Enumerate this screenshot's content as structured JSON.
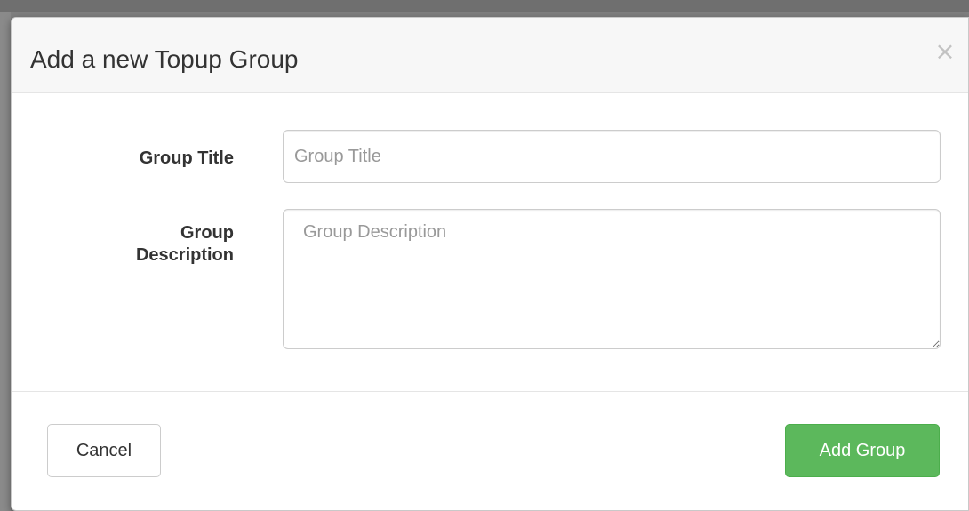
{
  "modal": {
    "title": "Add a new Topup Group",
    "close_glyph": "×"
  },
  "form": {
    "group_title": {
      "label": "Group Title",
      "placeholder": "Group Title",
      "value": ""
    },
    "group_description": {
      "label_line1": "Group",
      "label_line2": "Description",
      "placeholder": "Group Description",
      "value": ""
    }
  },
  "footer": {
    "cancel_label": "Cancel",
    "add_label": "Add Group"
  },
  "icons": {
    "close": "close-icon",
    "resize": "resize-handle-icon"
  },
  "colors": {
    "primary_success": "#5cb85c",
    "header_bg": "#f7f7f7",
    "text": "#333333",
    "placeholder": "#999999"
  }
}
